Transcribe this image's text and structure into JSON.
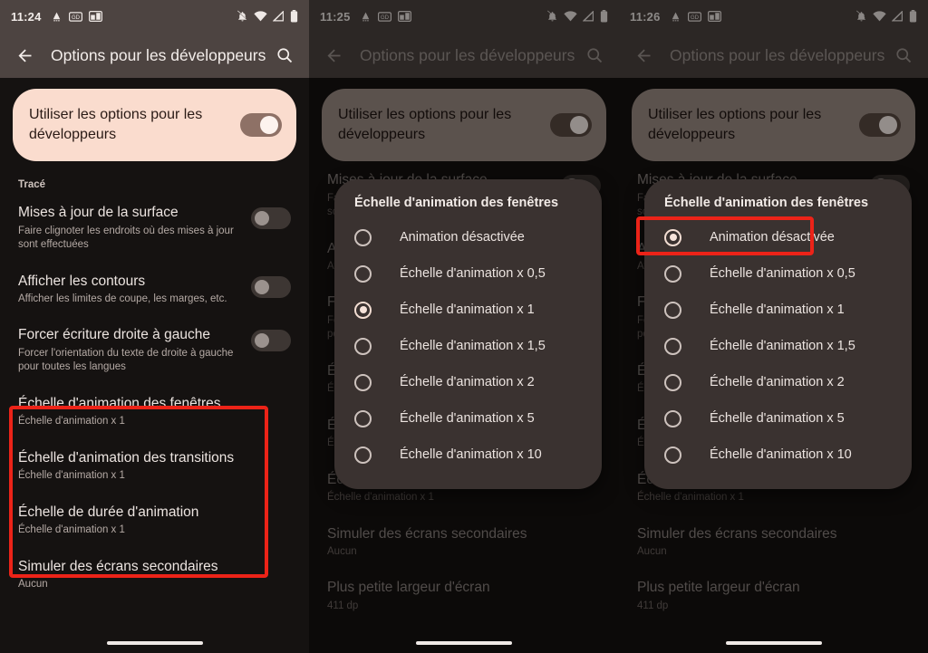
{
  "app": {
    "title": "Options pour les développeurs",
    "back_icon": "arrow-back-icon",
    "search_icon": "search-icon"
  },
  "status_bar": {
    "times": [
      "11:24",
      "11:25",
      "11:26"
    ],
    "left_icons": [
      "adb-icon",
      "gd-badge-icon",
      "screenshot-icon"
    ],
    "right_icons": [
      "notifications-off-icon",
      "wifi-icon",
      "signal-icon",
      "battery-icon"
    ]
  },
  "colors": {
    "accent_card": "#fadcce",
    "annotation_red": "#ec2318",
    "appbar": "#4d4441",
    "background": "#151211",
    "dialog": "#3a3230"
  },
  "master_toggle": {
    "label": "Utiliser les options pour les développeurs",
    "state": "on"
  },
  "section": {
    "label": "Tracé"
  },
  "settings_rows": [
    {
      "title": "Mises à jour de la surface",
      "subtitle": "Faire clignoter les endroits où des mises à jour sont effectuées",
      "toggle": "off"
    },
    {
      "title": "Afficher les contours",
      "subtitle": "Afficher les limites de coupe, les marges, etc.",
      "toggle": "off"
    },
    {
      "title": "Forcer écriture droite à gauche",
      "subtitle": "Forcer l'orientation du texte de droite à gauche pour toutes les langues",
      "toggle": "off"
    },
    {
      "title": "Échelle d'animation des fenêtres",
      "subtitle": "Échelle d'animation x 1"
    },
    {
      "title": "Échelle d'animation des transitions",
      "subtitle": "Échelle d'animation x 1"
    },
    {
      "title": "Échelle de durée d'animation",
      "subtitle": "Échelle d'animation x 1"
    },
    {
      "title": "Simuler des écrans secondaires",
      "subtitle": "Aucun"
    },
    {
      "title": "Plus petite largeur d'écran",
      "subtitle": "411 dp"
    }
  ],
  "dialog": {
    "title": "Échelle d'animation des fenêtres",
    "options": [
      "Animation désactivée",
      "Échelle d'animation x 0,5",
      "Échelle d'animation x 1",
      "Échelle d'animation x 1,5",
      "Échelle d'animation x 2",
      "Échelle d'animation x 5",
      "Échelle d'animation x 10"
    ],
    "selected_middle": "Échelle d'animation x 1",
    "selected_right": "Animation désactivée"
  }
}
